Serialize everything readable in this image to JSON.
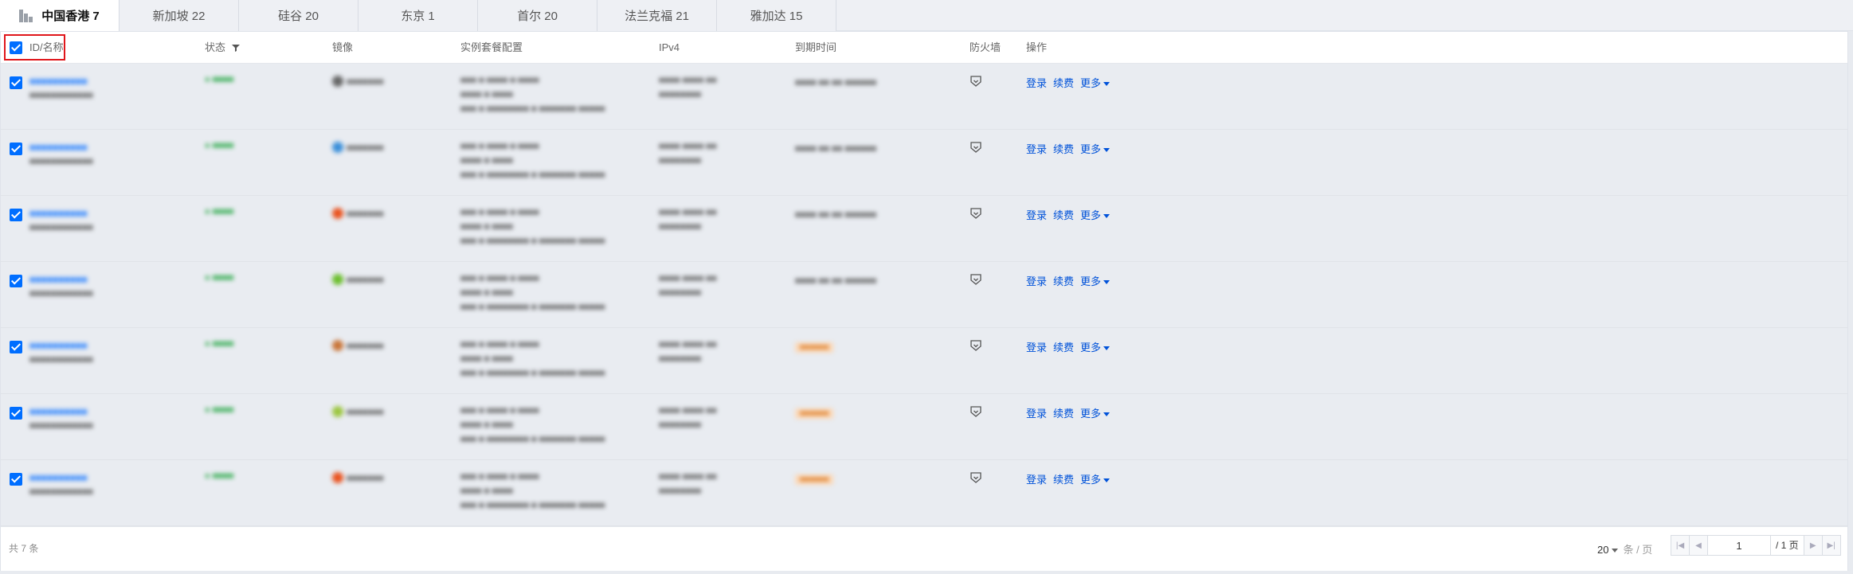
{
  "tabs": [
    {
      "label": "中国香港 7",
      "active": true
    },
    {
      "label": "新加坡 22"
    },
    {
      "label": "硅谷 20"
    },
    {
      "label": "东京 1"
    },
    {
      "label": "首尔 20"
    },
    {
      "label": "法兰克福 21"
    },
    {
      "label": "雅加达 15"
    }
  ],
  "table": {
    "headers": {
      "id_name": "ID/名称",
      "status": "状态",
      "image": "镜像",
      "plan": "实例套餐配置",
      "ipv4": "IPv4",
      "expiry": "到期时间",
      "firewall": "防火墙",
      "actions": "操作"
    },
    "row_actions": {
      "login": "登录",
      "renew": "续费",
      "more": "更多"
    },
    "rows": [
      {
        "os_color": "#666666",
        "expiry_style": "text"
      },
      {
        "os_color": "#3b8fd9",
        "expiry_style": "text"
      },
      {
        "os_color": "#e95420",
        "expiry_style": "text"
      },
      {
        "os_color": "#6cbf2e",
        "expiry_style": "text"
      },
      {
        "os_color": "#c9763a",
        "expiry_style": "badge"
      },
      {
        "os_color": "#9cc640",
        "expiry_style": "badge"
      },
      {
        "os_color": "#e95420",
        "expiry_style": "badge"
      }
    ]
  },
  "footer": {
    "total": "共 7 条",
    "page_size": "20",
    "page_size_unit": "条 / 页",
    "current_page": "1",
    "page_total": "/ 1 页"
  },
  "colors": {
    "accent": "#006eff",
    "link": "#0052d9",
    "highlight_border": "#e0161b"
  }
}
